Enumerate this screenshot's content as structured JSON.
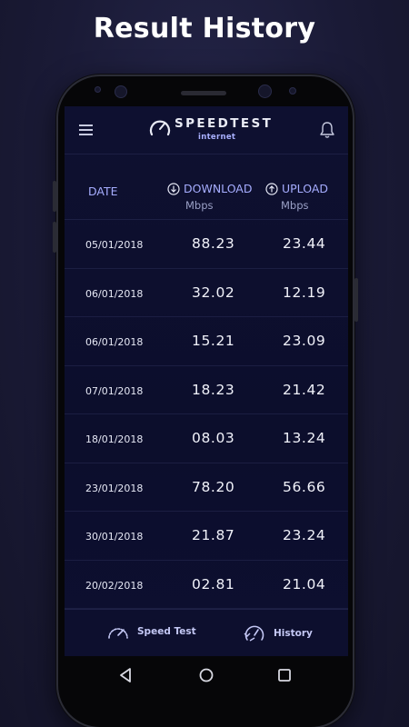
{
  "promo": {
    "title": "Result History"
  },
  "app": {
    "logo_word": "SPEEDTEST",
    "logo_sub": "internet"
  },
  "table": {
    "headers": {
      "date": "DATE",
      "download": "DOWNLOAD",
      "download_unit": "Mbps",
      "upload": "UPLOAD",
      "upload_unit": "Mbps"
    },
    "rows": [
      {
        "date": "05/01/2018",
        "download": "88.23",
        "upload": "23.44"
      },
      {
        "date": "06/01/2018",
        "download": "32.02",
        "upload": "12.19"
      },
      {
        "date": "06/01/2018",
        "download": "15.21",
        "upload": "23.09"
      },
      {
        "date": "07/01/2018",
        "download": "18.23",
        "upload": "21.42"
      },
      {
        "date": "18/01/2018",
        "download": "08.03",
        "upload": "13.24"
      },
      {
        "date": "23/01/2018",
        "download": "78.20",
        "upload": "56.66"
      },
      {
        "date": "30/01/2018",
        "download": "21.87",
        "upload": "23.24"
      },
      {
        "date": "20/02/2018",
        "download": "02.81",
        "upload": "21.04"
      }
    ]
  },
  "bottom_nav": {
    "speed_test": {
      "label": "Speed Test",
      "icon": "speedometer-icon"
    },
    "history": {
      "label": "History",
      "icon": "history-gauge-icon"
    }
  },
  "icons": {
    "menu": "hamburger-menu-icon",
    "bell": "notification-bell-icon",
    "back": "back-triangle-icon",
    "home": "home-circle-icon",
    "recents": "recents-square-icon"
  },
  "colors": {
    "accent": "#a6adff",
    "screen_bg": "#0e1030",
    "page_bg": "#1a1a36"
  }
}
